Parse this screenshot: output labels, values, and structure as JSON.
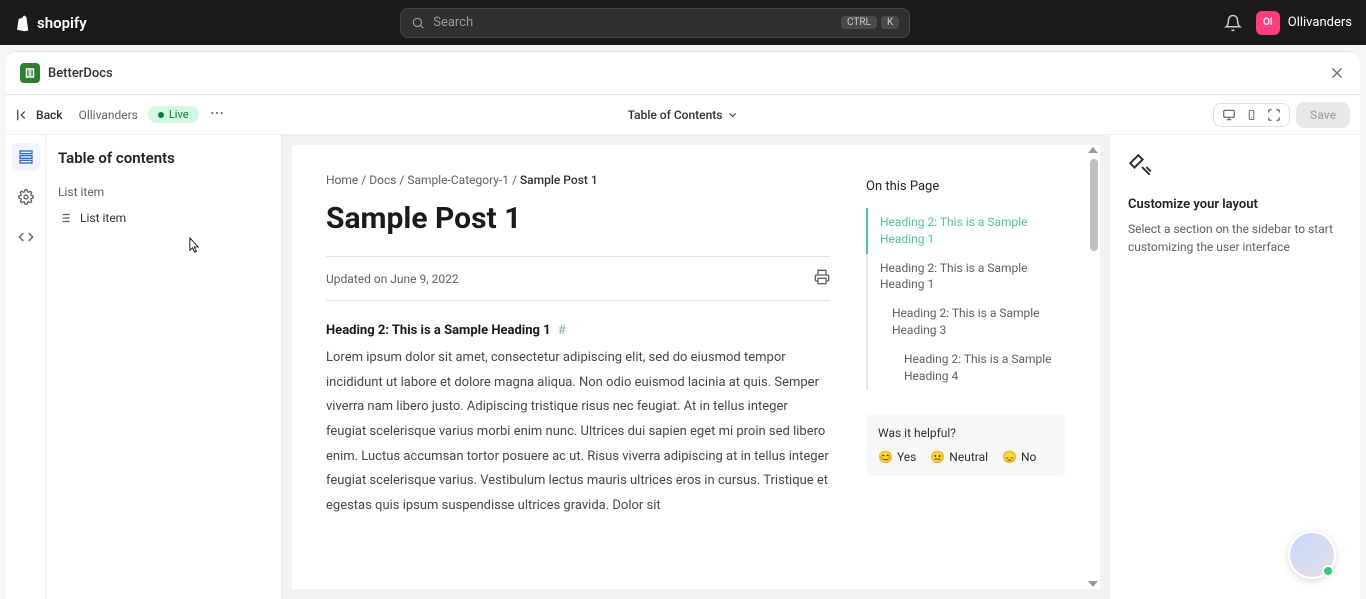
{
  "topbar": {
    "logo": "shopify",
    "search_placeholder": "Search",
    "kbd1": "CTRL",
    "kbd2": "K",
    "user_initials": "Ol",
    "user_name": "Ollivanders"
  },
  "app": {
    "name": "BetterDocs"
  },
  "toolbar": {
    "back": "Back",
    "crumb": "Ollivanders",
    "live": "Live",
    "center": "Table of Contents",
    "save": "Save"
  },
  "sidepanel": {
    "title": "Table of contents",
    "section": "List item",
    "node1": "List item"
  },
  "breadcrumb": {
    "home": "Home",
    "docs": "Docs",
    "cat": "Sample-Category-1",
    "current": "Sample Post 1",
    "sep": "/"
  },
  "article": {
    "title": "Sample Post 1",
    "updated": "Updated on June 9, 2022",
    "h2": "Heading 2: This is a Sample Heading 1",
    "hash": "#",
    "body": "Lorem ipsum dolor sit amet, consectetur adipiscing elit, sed do eiusmod tempor incididunt ut labore et dolore magna aliqua. Non odio euismod lacinia at quis. Semper viverra nam libero justo. Adipiscing tristique risus nec feugiat. At in tellus integer feugiat scelerisque varius morbi enim nunc. Ultrices dui sapien eget mi proin sed libero enim. Luctus accumsan tortor posuere ac ut. Risus viverra adipiscing at in tellus integer feugiat scelerisque varius. Vestibulum lectus mauris ultrices eros in cursus. Tristique et egestas quis ipsum suspendisse ultrices gravida. Dolor sit"
  },
  "onpage": {
    "title": "On this Page",
    "items": [
      {
        "label": "Heading 2: This is a Sample Heading 1",
        "active": true,
        "level": 1
      },
      {
        "label": "Heading 2: This is a Sample Heading 1",
        "active": false,
        "level": 1
      },
      {
        "label": "Heading 2: This is a Sample Heading 3",
        "active": false,
        "level": 2
      },
      {
        "label": "Heading 2: This is a Sample Heading 4",
        "active": false,
        "level": 3
      }
    ]
  },
  "helpbox": {
    "q": "Was it helpful?",
    "yes": "Yes",
    "neutral": "Neutral",
    "no": "No"
  },
  "rightpanel": {
    "heading": "Customize your layout",
    "desc": "Select a section on the sidebar to start customizing the user interface"
  }
}
